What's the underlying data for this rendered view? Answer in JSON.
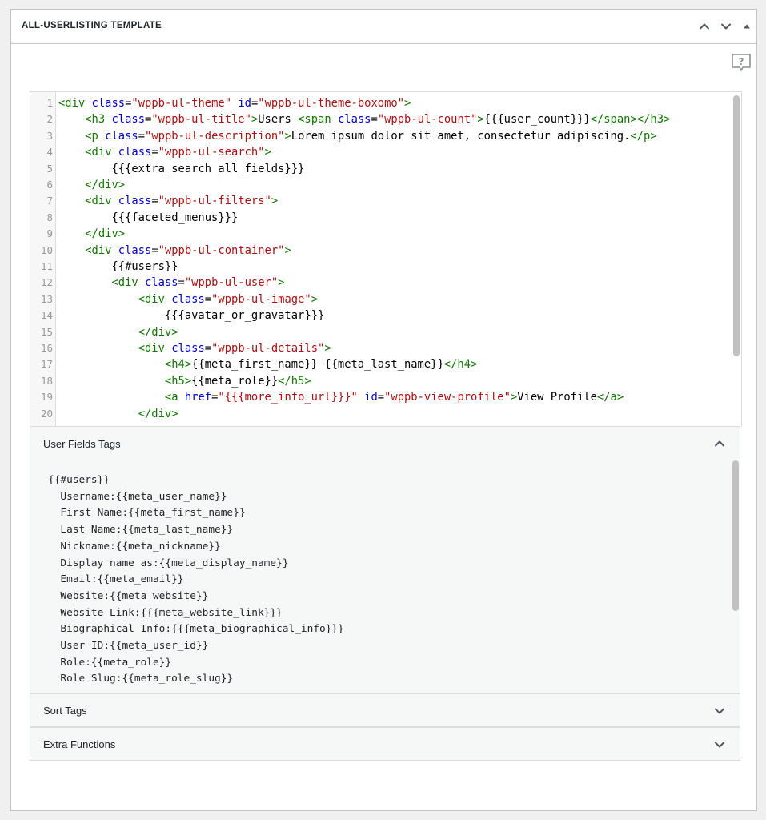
{
  "metabox": {
    "title": "ALL-USERLISTING TEMPLATE"
  },
  "icons": {
    "move_up": "chevron-up-icon",
    "move_down": "chevron-down-icon",
    "toggle": "triangle-up-icon",
    "help": "help-icon"
  },
  "editor": {
    "line_numbers": [
      "1",
      "2",
      "3",
      "4",
      "5",
      "6",
      "7",
      "8",
      "9",
      "10",
      "11",
      "12",
      "13",
      "14",
      "15",
      "16",
      "17",
      "18",
      "19",
      "20"
    ],
    "lines": [
      [
        {
          "c": "tg",
          "t": "<div"
        },
        {
          "c": "",
          "t": " "
        },
        {
          "c": "at",
          "t": "class"
        },
        {
          "c": "",
          "t": "="
        },
        {
          "c": "st",
          "t": "\"wppb-ul-theme\""
        },
        {
          "c": "",
          "t": " "
        },
        {
          "c": "at",
          "t": "id"
        },
        {
          "c": "",
          "t": "="
        },
        {
          "c": "st",
          "t": "\"wppb-ul-theme-boxomo\""
        },
        {
          "c": "tg",
          "t": ">"
        }
      ],
      [
        {
          "c": "",
          "t": "    "
        },
        {
          "c": "tg",
          "t": "<h3"
        },
        {
          "c": "",
          "t": " "
        },
        {
          "c": "at",
          "t": "class"
        },
        {
          "c": "",
          "t": "="
        },
        {
          "c": "st",
          "t": "\"wppb-ul-title\""
        },
        {
          "c": "tg",
          "t": ">"
        },
        {
          "c": "",
          "t": "Users "
        },
        {
          "c": "tg",
          "t": "<span"
        },
        {
          "c": "",
          "t": " "
        },
        {
          "c": "at",
          "t": "class"
        },
        {
          "c": "",
          "t": "="
        },
        {
          "c": "st",
          "t": "\"wppb-ul-count\""
        },
        {
          "c": "tg",
          "t": ">"
        },
        {
          "c": "",
          "t": "{{{user_count}}}"
        },
        {
          "c": "tg",
          "t": "</span></h3>"
        }
      ],
      [
        {
          "c": "",
          "t": "    "
        },
        {
          "c": "tg",
          "t": "<p"
        },
        {
          "c": "",
          "t": " "
        },
        {
          "c": "at",
          "t": "class"
        },
        {
          "c": "",
          "t": "="
        },
        {
          "c": "st",
          "t": "\"wppb-ul-description\""
        },
        {
          "c": "tg",
          "t": ">"
        },
        {
          "c": "",
          "t": "Lorem ipsum dolor sit amet, consectetur adipiscing."
        },
        {
          "c": "tg",
          "t": "</p>"
        }
      ],
      [
        {
          "c": "",
          "t": "    "
        },
        {
          "c": "tg",
          "t": "<div"
        },
        {
          "c": "",
          "t": " "
        },
        {
          "c": "at",
          "t": "class"
        },
        {
          "c": "",
          "t": "="
        },
        {
          "c": "st",
          "t": "\"wppb-ul-search\""
        },
        {
          "c": "tg",
          "t": ">"
        }
      ],
      [
        {
          "c": "",
          "t": "        {{{extra_search_all_fields}}}"
        }
      ],
      [
        {
          "c": "",
          "t": "    "
        },
        {
          "c": "tg",
          "t": "</div>"
        }
      ],
      [
        {
          "c": "",
          "t": "    "
        },
        {
          "c": "tg",
          "t": "<div"
        },
        {
          "c": "",
          "t": " "
        },
        {
          "c": "at",
          "t": "class"
        },
        {
          "c": "",
          "t": "="
        },
        {
          "c": "st",
          "t": "\"wppb-ul-filters\""
        },
        {
          "c": "tg",
          "t": ">"
        }
      ],
      [
        {
          "c": "",
          "t": "        {{{faceted_menus}}}"
        }
      ],
      [
        {
          "c": "",
          "t": "    "
        },
        {
          "c": "tg",
          "t": "</div>"
        }
      ],
      [
        {
          "c": "",
          "t": "    "
        },
        {
          "c": "tg",
          "t": "<div"
        },
        {
          "c": "",
          "t": " "
        },
        {
          "c": "at",
          "t": "class"
        },
        {
          "c": "",
          "t": "="
        },
        {
          "c": "st",
          "t": "\"wppb-ul-container\""
        },
        {
          "c": "tg",
          "t": ">"
        }
      ],
      [
        {
          "c": "",
          "t": "        {{#users}}"
        }
      ],
      [
        {
          "c": "",
          "t": "        "
        },
        {
          "c": "tg",
          "t": "<div"
        },
        {
          "c": "",
          "t": " "
        },
        {
          "c": "at",
          "t": "class"
        },
        {
          "c": "",
          "t": "="
        },
        {
          "c": "st",
          "t": "\"wppb-ul-user\""
        },
        {
          "c": "tg",
          "t": ">"
        }
      ],
      [
        {
          "c": "",
          "t": "            "
        },
        {
          "c": "tg",
          "t": "<div"
        },
        {
          "c": "",
          "t": " "
        },
        {
          "c": "at",
          "t": "class"
        },
        {
          "c": "",
          "t": "="
        },
        {
          "c": "st",
          "t": "\"wppb-ul-image\""
        },
        {
          "c": "tg",
          "t": ">"
        }
      ],
      [
        {
          "c": "",
          "t": "                {{{avatar_or_gravatar}}}"
        }
      ],
      [
        {
          "c": "",
          "t": "            "
        },
        {
          "c": "tg",
          "t": "</div>"
        }
      ],
      [
        {
          "c": "",
          "t": "            "
        },
        {
          "c": "tg",
          "t": "<div"
        },
        {
          "c": "",
          "t": " "
        },
        {
          "c": "at",
          "t": "class"
        },
        {
          "c": "",
          "t": "="
        },
        {
          "c": "st",
          "t": "\"wppb-ul-details\""
        },
        {
          "c": "tg",
          "t": ">"
        }
      ],
      [
        {
          "c": "",
          "t": "                "
        },
        {
          "c": "tg",
          "t": "<h4>"
        },
        {
          "c": "",
          "t": "{{meta_first_name}} {{meta_last_name}}"
        },
        {
          "c": "tg",
          "t": "</h4>"
        }
      ],
      [
        {
          "c": "",
          "t": "                "
        },
        {
          "c": "tg",
          "t": "<h5>"
        },
        {
          "c": "",
          "t": "{{meta_role}}"
        },
        {
          "c": "tg",
          "t": "</h5>"
        }
      ],
      [
        {
          "c": "",
          "t": "                "
        },
        {
          "c": "tg",
          "t": "<a"
        },
        {
          "c": "",
          "t": " "
        },
        {
          "c": "at",
          "t": "href"
        },
        {
          "c": "",
          "t": "="
        },
        {
          "c": "st",
          "t": "\"{{{more_info_url}}}\""
        },
        {
          "c": "",
          "t": " "
        },
        {
          "c": "at",
          "t": "id"
        },
        {
          "c": "",
          "t": "="
        },
        {
          "c": "st",
          "t": "\"wppb-view-profile\""
        },
        {
          "c": "tg",
          "t": ">"
        },
        {
          "c": "",
          "t": "View Profile"
        },
        {
          "c": "tg",
          "t": "</a>"
        }
      ],
      [
        {
          "c": "",
          "t": "            "
        },
        {
          "c": "tg",
          "t": "</div>"
        }
      ]
    ]
  },
  "accordions": {
    "user_fields": {
      "title": "User Fields Tags",
      "expanded": true,
      "tags": [
        "{{#users}}",
        "  Username:{{meta_user_name}}",
        "  First Name:{{meta_first_name}}",
        "  Last Name:{{meta_last_name}}",
        "  Nickname:{{meta_nickname}}",
        "  Display name as:{{meta_display_name}}",
        "  Email:{{meta_email}}",
        "  Website:{{meta_website}}",
        "  Website Link:{{{meta_website_link}}}",
        "  Biographical Info:{{{meta_biographical_info}}}",
        "  User ID:{{meta_user_id}}",
        "  Role:{{meta_role}}",
        "  Role Slug:{{meta_role_slug}}"
      ]
    },
    "sort_tags": {
      "title": "Sort Tags",
      "expanded": false
    },
    "extra_functions": {
      "title": "Extra Functions",
      "expanded": false
    }
  },
  "colors": {
    "tag": "#117700",
    "attribute": "#0000cc",
    "string": "#aa1111",
    "border": "#c3c4c7"
  }
}
